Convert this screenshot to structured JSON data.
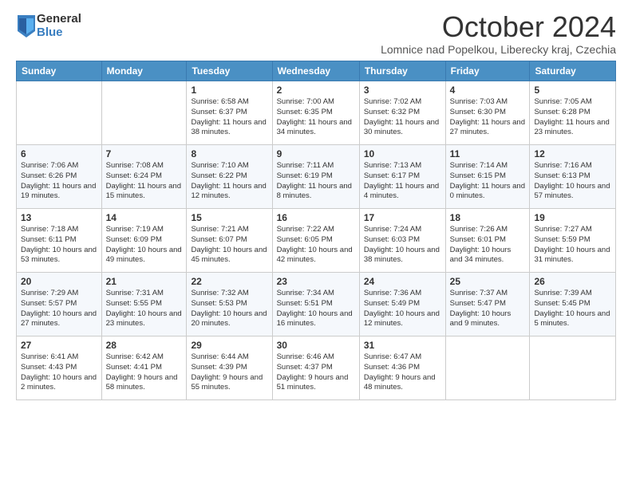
{
  "logo": {
    "general": "General",
    "blue": "Blue"
  },
  "title": "October 2024",
  "location": "Lomnice nad Popelkou, Liberecky kraj, Czechia",
  "days_of_week": [
    "Sunday",
    "Monday",
    "Tuesday",
    "Wednesday",
    "Thursday",
    "Friday",
    "Saturday"
  ],
  "weeks": [
    [
      {
        "day": "",
        "detail": ""
      },
      {
        "day": "",
        "detail": ""
      },
      {
        "day": "1",
        "detail": "Sunrise: 6:58 AM\nSunset: 6:37 PM\nDaylight: 11 hours and 38 minutes."
      },
      {
        "day": "2",
        "detail": "Sunrise: 7:00 AM\nSunset: 6:35 PM\nDaylight: 11 hours and 34 minutes."
      },
      {
        "day": "3",
        "detail": "Sunrise: 7:02 AM\nSunset: 6:32 PM\nDaylight: 11 hours and 30 minutes."
      },
      {
        "day": "4",
        "detail": "Sunrise: 7:03 AM\nSunset: 6:30 PM\nDaylight: 11 hours and 27 minutes."
      },
      {
        "day": "5",
        "detail": "Sunrise: 7:05 AM\nSunset: 6:28 PM\nDaylight: 11 hours and 23 minutes."
      }
    ],
    [
      {
        "day": "6",
        "detail": "Sunrise: 7:06 AM\nSunset: 6:26 PM\nDaylight: 11 hours and 19 minutes."
      },
      {
        "day": "7",
        "detail": "Sunrise: 7:08 AM\nSunset: 6:24 PM\nDaylight: 11 hours and 15 minutes."
      },
      {
        "day": "8",
        "detail": "Sunrise: 7:10 AM\nSunset: 6:22 PM\nDaylight: 11 hours and 12 minutes."
      },
      {
        "day": "9",
        "detail": "Sunrise: 7:11 AM\nSunset: 6:19 PM\nDaylight: 11 hours and 8 minutes."
      },
      {
        "day": "10",
        "detail": "Sunrise: 7:13 AM\nSunset: 6:17 PM\nDaylight: 11 hours and 4 minutes."
      },
      {
        "day": "11",
        "detail": "Sunrise: 7:14 AM\nSunset: 6:15 PM\nDaylight: 11 hours and 0 minutes."
      },
      {
        "day": "12",
        "detail": "Sunrise: 7:16 AM\nSunset: 6:13 PM\nDaylight: 10 hours and 57 minutes."
      }
    ],
    [
      {
        "day": "13",
        "detail": "Sunrise: 7:18 AM\nSunset: 6:11 PM\nDaylight: 10 hours and 53 minutes."
      },
      {
        "day": "14",
        "detail": "Sunrise: 7:19 AM\nSunset: 6:09 PM\nDaylight: 10 hours and 49 minutes."
      },
      {
        "day": "15",
        "detail": "Sunrise: 7:21 AM\nSunset: 6:07 PM\nDaylight: 10 hours and 45 minutes."
      },
      {
        "day": "16",
        "detail": "Sunrise: 7:22 AM\nSunset: 6:05 PM\nDaylight: 10 hours and 42 minutes."
      },
      {
        "day": "17",
        "detail": "Sunrise: 7:24 AM\nSunset: 6:03 PM\nDaylight: 10 hours and 38 minutes."
      },
      {
        "day": "18",
        "detail": "Sunrise: 7:26 AM\nSunset: 6:01 PM\nDaylight: 10 hours and 34 minutes."
      },
      {
        "day": "19",
        "detail": "Sunrise: 7:27 AM\nSunset: 5:59 PM\nDaylight: 10 hours and 31 minutes."
      }
    ],
    [
      {
        "day": "20",
        "detail": "Sunrise: 7:29 AM\nSunset: 5:57 PM\nDaylight: 10 hours and 27 minutes."
      },
      {
        "day": "21",
        "detail": "Sunrise: 7:31 AM\nSunset: 5:55 PM\nDaylight: 10 hours and 23 minutes."
      },
      {
        "day": "22",
        "detail": "Sunrise: 7:32 AM\nSunset: 5:53 PM\nDaylight: 10 hours and 20 minutes."
      },
      {
        "day": "23",
        "detail": "Sunrise: 7:34 AM\nSunset: 5:51 PM\nDaylight: 10 hours and 16 minutes."
      },
      {
        "day": "24",
        "detail": "Sunrise: 7:36 AM\nSunset: 5:49 PM\nDaylight: 10 hours and 12 minutes."
      },
      {
        "day": "25",
        "detail": "Sunrise: 7:37 AM\nSunset: 5:47 PM\nDaylight: 10 hours and 9 minutes."
      },
      {
        "day": "26",
        "detail": "Sunrise: 7:39 AM\nSunset: 5:45 PM\nDaylight: 10 hours and 5 minutes."
      }
    ],
    [
      {
        "day": "27",
        "detail": "Sunrise: 6:41 AM\nSunset: 4:43 PM\nDaylight: 10 hours and 2 minutes."
      },
      {
        "day": "28",
        "detail": "Sunrise: 6:42 AM\nSunset: 4:41 PM\nDaylight: 9 hours and 58 minutes."
      },
      {
        "day": "29",
        "detail": "Sunrise: 6:44 AM\nSunset: 4:39 PM\nDaylight: 9 hours and 55 minutes."
      },
      {
        "day": "30",
        "detail": "Sunrise: 6:46 AM\nSunset: 4:37 PM\nDaylight: 9 hours and 51 minutes."
      },
      {
        "day": "31",
        "detail": "Sunrise: 6:47 AM\nSunset: 4:36 PM\nDaylight: 9 hours and 48 minutes."
      },
      {
        "day": "",
        "detail": ""
      },
      {
        "day": "",
        "detail": ""
      }
    ]
  ]
}
